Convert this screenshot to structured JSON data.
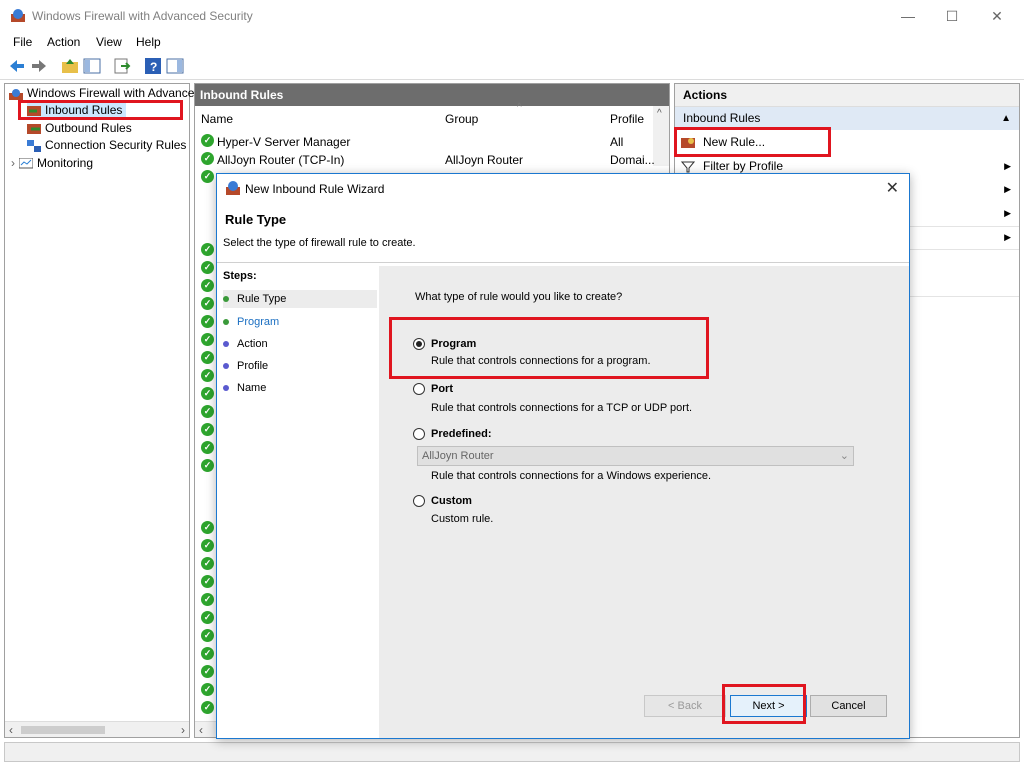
{
  "window": {
    "title": "Windows Firewall with Advanced Security",
    "min": "—",
    "max": "☐",
    "close": "✕"
  },
  "menu": [
    "File",
    "Action",
    "View",
    "Help"
  ],
  "tree": {
    "root": "Windows Firewall with Advance",
    "items": [
      "Inbound Rules",
      "Outbound Rules",
      "Connection Security Rules",
      "Monitoring"
    ]
  },
  "center": {
    "header": "Inbound Rules",
    "columns": [
      "Name",
      "Group",
      "Profile"
    ],
    "rows": [
      {
        "name": "Hyper-V Server Manager",
        "group": "",
        "profile": "All"
      },
      {
        "name": "AllJoyn Router (TCP-In)",
        "group": "AllJoyn Router",
        "profile": "Domai..."
      }
    ]
  },
  "actions": {
    "header": "Actions",
    "section": "Inbound Rules",
    "new_rule": "New Rule...",
    "filter_profile": "Filter by Profile"
  },
  "dialog": {
    "title": "New Inbound Rule Wizard",
    "heading": "Rule Type",
    "subtitle": "Select the type of firewall rule to create.",
    "steps_label": "Steps:",
    "steps": [
      "Rule Type",
      "Program",
      "Action",
      "Profile",
      "Name"
    ],
    "question": "What type of rule would you like to create?",
    "options": [
      {
        "label": "Program",
        "desc": "Rule that controls connections for a program."
      },
      {
        "label": "Port",
        "desc": "Rule that controls connections for a TCP or UDP port."
      },
      {
        "label": "Predefined:",
        "desc": "Rule that controls connections for a Windows experience."
      },
      {
        "label": "Custom",
        "desc": "Custom rule."
      }
    ],
    "predefined_value": "AllJoyn Router",
    "back": "< Back",
    "next": "Next >",
    "cancel": "Cancel"
  },
  "colors": {
    "highlight": "#e0151f",
    "header_bg": "#6d6d6d",
    "accent": "#1b78d0"
  }
}
